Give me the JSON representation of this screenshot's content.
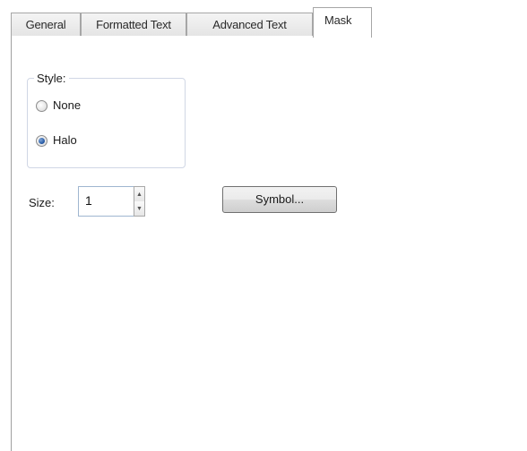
{
  "tabs": [
    {
      "label": "General",
      "active": false
    },
    {
      "label": "Formatted Text",
      "active": false
    },
    {
      "label": "Advanced Text",
      "active": false
    },
    {
      "label": "Mask",
      "active": true
    }
  ],
  "style_group": {
    "legend": "Style:",
    "options": [
      {
        "label": "None",
        "checked": false
      },
      {
        "label": "Halo",
        "checked": true
      }
    ]
  },
  "size": {
    "label": "Size:",
    "value": "1"
  },
  "symbol_button": {
    "label": "Symbol..."
  },
  "colors": {
    "panel_border": "#a0a0a0",
    "radio_checked": "#2b5ea8",
    "group_border": "#d0d7e5"
  },
  "icons": {
    "spin_up": "up-arrow-icon",
    "spin_down": "down-arrow-icon"
  }
}
